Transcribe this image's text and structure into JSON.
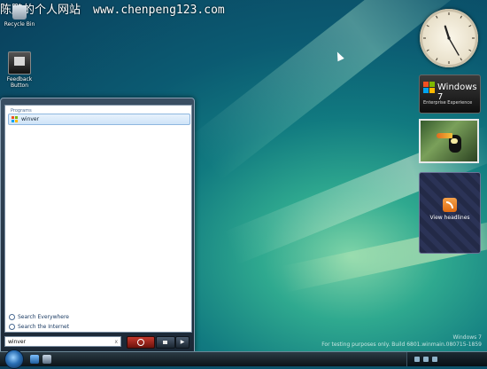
{
  "watermark": {
    "site_name": "陈鹏的个人网站",
    "url": "www.chenpeng123.com"
  },
  "desktop": {
    "icons": [
      {
        "label": "Recycle Bin",
        "icon": "recycle-bin-icon"
      },
      {
        "label": "Feedback Button",
        "icon": "feedback-button-icon"
      }
    ]
  },
  "gadgets": {
    "clock": {
      "hour": 11,
      "minute": 25
    },
    "windows7": {
      "title": "Windows 7",
      "subtitle": "Enterprise Experience"
    },
    "slideshow": {
      "subject": "toucan"
    },
    "feeds": {
      "label": "View headlines",
      "icon": "rss-icon"
    }
  },
  "start_menu": {
    "programs_header": "Programs",
    "result": {
      "label": "winver",
      "icon": "windows-flag-icon"
    },
    "search_links": [
      "Search Everywhere",
      "Search the Internet"
    ],
    "search_box": {
      "value": "winver",
      "clear": "x"
    },
    "power_icon": "power-icon",
    "lock_icon": "lock-icon",
    "arrow": "▶"
  },
  "build": {
    "line1": "Windows 7",
    "line2": "For testing purposes only. Build 6801.winmain.080715-1859"
  },
  "taskbar": {
    "tray_icons": [
      "network-icon",
      "volume-icon",
      "battery-icon"
    ],
    "clock": ""
  },
  "colors": {
    "accent": "#2a6fb5",
    "wallpaper": "#117a80",
    "result_highlight": "#cfe4f8",
    "power": "#c5392d"
  }
}
